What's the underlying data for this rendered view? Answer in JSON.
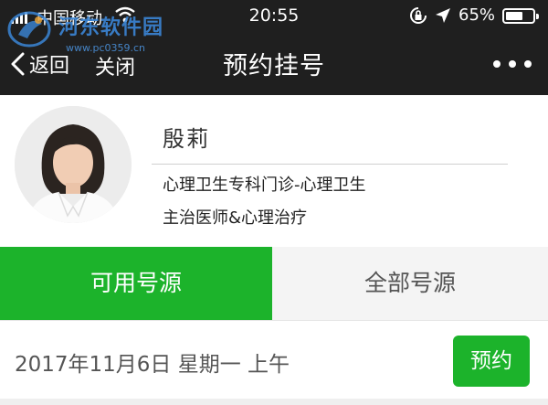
{
  "status_bar": {
    "carrier": "中国移动",
    "time": "20:55",
    "battery_percent": "65%",
    "battery_level": 0.65
  },
  "watermark": {
    "title": "河东软件园",
    "url": "www.pc0359.cn"
  },
  "nav": {
    "back_label": "返回",
    "close_label": "关闭",
    "title": "预约挂号"
  },
  "doctor": {
    "name": "殷莉",
    "department": "心理卫生专科门诊-心理卫生",
    "title": "主治医师&心理治疗"
  },
  "tabs": [
    {
      "label": "可用号源",
      "active": true
    },
    {
      "label": "全部号源",
      "active": false
    }
  ],
  "schedule": [
    {
      "date": "2017年11月6日 星期一 上午",
      "button": "预约"
    }
  ],
  "colors": {
    "accent": "#1cb32b",
    "topbar": "#1f1f1f"
  }
}
